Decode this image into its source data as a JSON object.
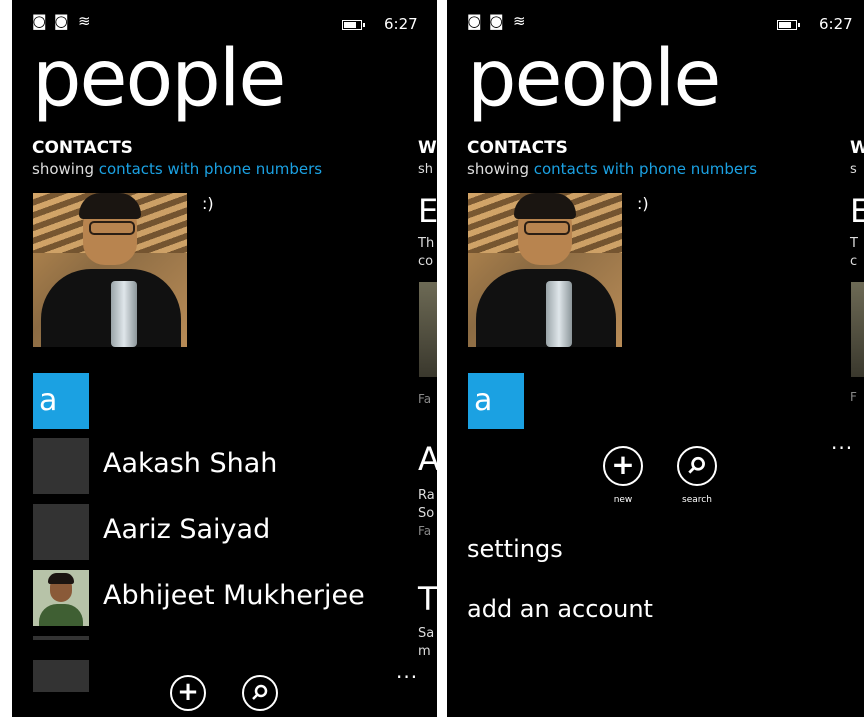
{
  "left": {
    "status": {
      "time": "6:27"
    },
    "title": "people",
    "section_heading": "CONTACTS",
    "section_sub_prefix": "showing",
    "section_sub_link": "contacts with phone numbers",
    "profile_status": ":)",
    "group_letter": "a",
    "contacts": [
      {
        "name": "Aakash Shah",
        "photo": "none"
      },
      {
        "name": "Aariz Saiyad",
        "photo": "none"
      },
      {
        "name": "Abhijeet Mukherjee",
        "photo": "face"
      }
    ],
    "peek": {
      "heading": "W",
      "sub": "sh",
      "big1": "E",
      "line1": "Th",
      "line2": "co",
      "gray1": "Fa",
      "big2": "A",
      "line3": "Ra",
      "line4": "So",
      "gray2": "Fa",
      "big3": "T",
      "line5": "Sa",
      "line6": "m"
    },
    "appbar": {
      "ellipsis": "..."
    }
  },
  "right": {
    "status": {
      "time": "6:27"
    },
    "title": "people",
    "section_heading": "CONTACTS",
    "section_sub_prefix": "showing",
    "section_sub_link": "contacts with phone numbers",
    "profile_status": ":)",
    "group_letter": "a",
    "appbar": {
      "new_label": "new",
      "search_label": "search",
      "ellipsis": "..."
    },
    "menu": [
      "settings",
      "add an account"
    ],
    "peek": {
      "heading": "W",
      "sub": "s",
      "big1": "E",
      "line1": "T",
      "line2": "c",
      "gray1": "F"
    }
  },
  "icons": {
    "signal": "signal-icon",
    "wifi": "wifi-icon",
    "battery": "battery-icon",
    "new": "add-icon",
    "search": "search-icon"
  },
  "colors": {
    "accent": "#1ba1e2",
    "background": "#000000"
  }
}
